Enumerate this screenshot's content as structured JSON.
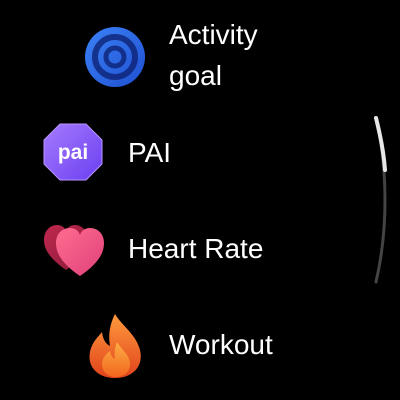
{
  "menu": {
    "items": [
      {
        "id": "activity-goal",
        "label": "Activity goal",
        "icon": "target-rings-icon",
        "icon_color": "#2f6ff0"
      },
      {
        "id": "pai",
        "label": "PAI",
        "icon": "pai-badge-icon",
        "icon_text": "pai",
        "icon_color": "#8e5cf7"
      },
      {
        "id": "heart-rate",
        "label": "Heart Rate",
        "icon": "heart-icon",
        "icon_color": "#e0507a"
      },
      {
        "id": "workout",
        "label": "Workout",
        "icon": "flame-icon",
        "icon_color": "#f47a2a"
      }
    ]
  },
  "scrollbar": {
    "position": "top",
    "track_color": "#444444",
    "thumb_color": "#e8e8e8"
  }
}
